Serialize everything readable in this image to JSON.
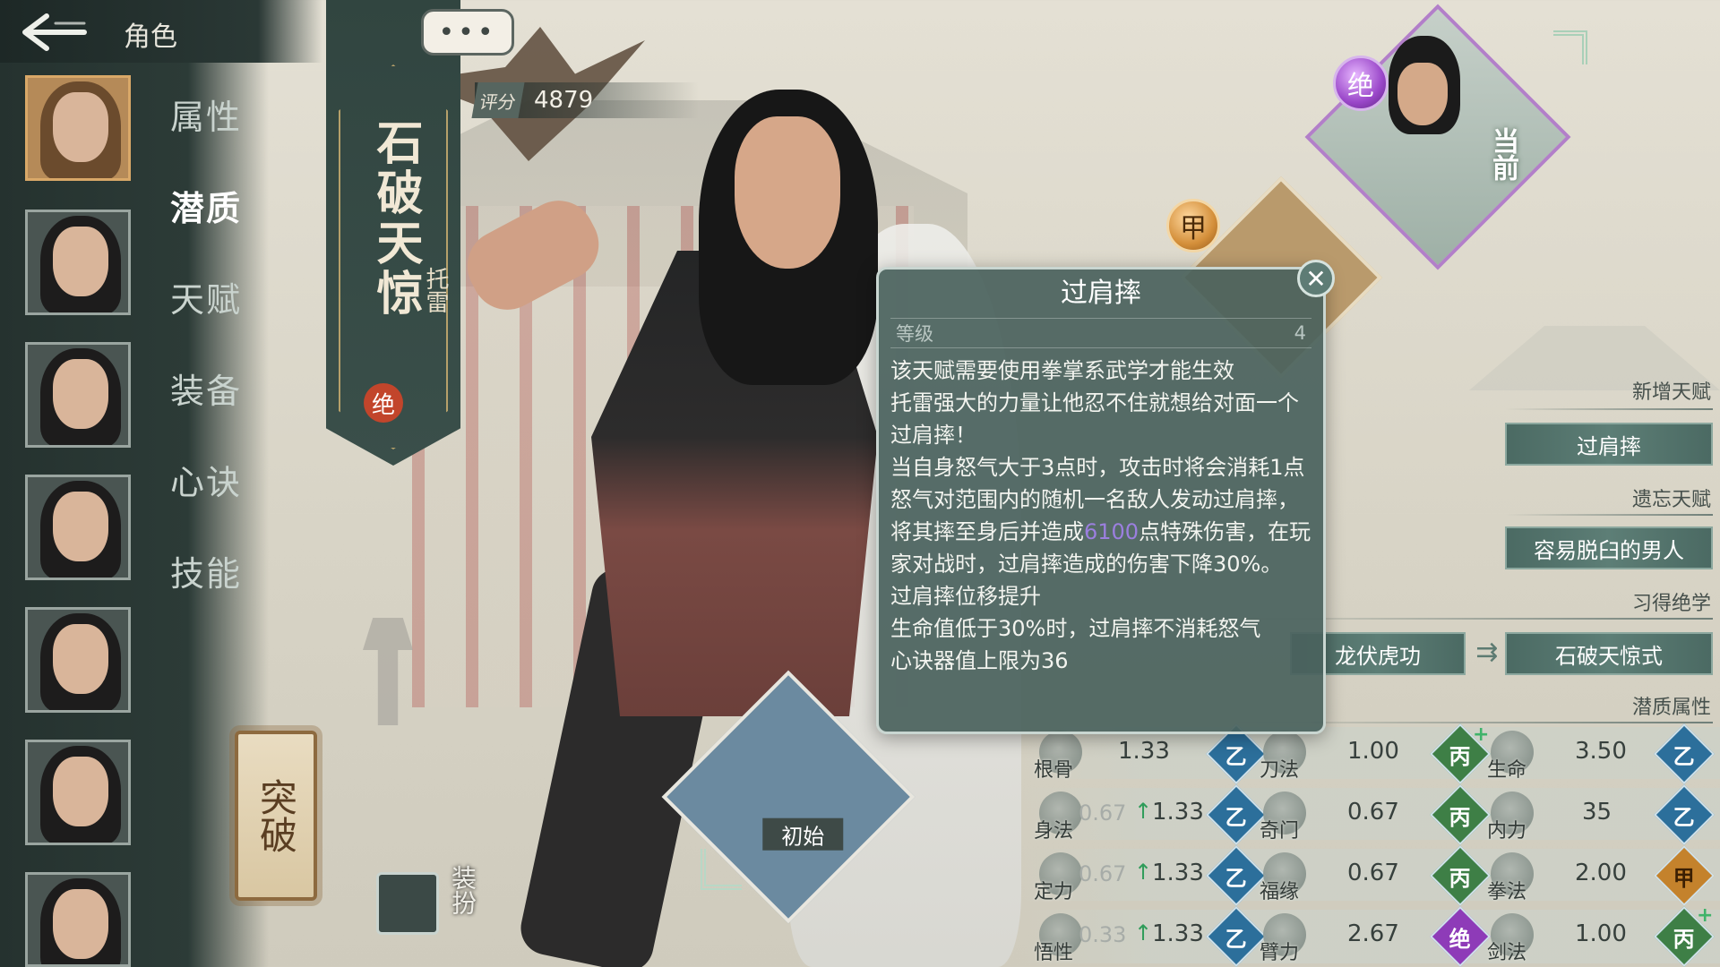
{
  "header": {
    "title": "角色"
  },
  "menu": [
    "属性",
    "潜质",
    "天赋",
    "装备",
    "心诀",
    "技能"
  ],
  "menu_selected": "潜质",
  "character": {
    "name": "石破天惊",
    "subtitle": "托雷",
    "grade": "绝",
    "score_label": "评分",
    "score": "4879"
  },
  "chat_button": "•••",
  "breakthrough_label": "突破",
  "dress_label": "装扮",
  "cards": {
    "current_label": "当前",
    "current_grade": "绝",
    "second_grade": "甲",
    "initial_label": "初始"
  },
  "tooltip": {
    "title": "过肩摔",
    "level_label": "等级",
    "level_value": "4",
    "lines": {
      "l1": "该天赋需要使用拳掌系武学才能生效",
      "l2": "托雷强大的力量让他忍不住就想给对面一个过肩摔！",
      "l3a": "当自身怒气大于3点时，攻击时将会消耗1点怒气对范围内的随机一名敌人发动过肩摔，将其摔至身后并造成",
      "l3num": "6100",
      "l3b": "点特殊伤害，在玩家对战时，过肩摔造成的伤害下降30%。",
      "l4": "过肩摔位移提升",
      "l5": "生命值低于30%时，过肩摔不消耗怒气",
      "l6": "心诀器值上限为36"
    },
    "highlight_color": "#9b7fdf",
    "close_icon": "close-icon"
  },
  "panel": {
    "new_talent_title": "新增天赋",
    "new_talent": "过肩摔",
    "forget_talent_title": "遗忘天赋",
    "forget_talent": "容易脱臼的男人",
    "skill_title": "习得绝学",
    "skill_from": "龙伏虎功",
    "skill_to": "石破天惊式",
    "potential_title": "潜质属性"
  },
  "stats": {
    "r1": {
      "c1": {
        "label": "根骨",
        "value": "1.33",
        "grade": "乙"
      },
      "c2": {
        "label": "刀法",
        "value": "1.00",
        "grade": "丙",
        "plus": "+"
      },
      "c3": {
        "label": "生命",
        "value": "3.50",
        "grade": "乙"
      }
    },
    "r2": {
      "c1": {
        "label": "身法",
        "old": "0.67",
        "arrow": "↑",
        "value": "1.33",
        "grade": "乙"
      },
      "c2": {
        "label": "奇门",
        "value": "0.67",
        "grade": "丙"
      },
      "c3": {
        "label": "内力",
        "value": "35",
        "grade": "乙"
      }
    },
    "r3": {
      "c1": {
        "label": "定力",
        "old": "0.67",
        "arrow": "↑",
        "value": "1.33",
        "grade": "乙"
      },
      "c2": {
        "label": "福缘",
        "value": "0.67",
        "grade": "丙"
      },
      "c3": {
        "label": "拳法",
        "value": "2.00",
        "grade": "甲"
      }
    },
    "r4": {
      "c1": {
        "label": "悟性",
        "old": "0.33",
        "arrow": "↑",
        "value": "1.33",
        "grade": "乙"
      },
      "c2": {
        "label": "臂力",
        "value": "2.67",
        "grade": "绝"
      },
      "c3": {
        "label": "剑法",
        "value": "1.00",
        "grade": "丙",
        "plus": "+"
      }
    }
  },
  "colors": {
    "panel_dark": "#2c3b37",
    "accent_gold": "#b6a06a",
    "grade_yi": "#2c6f9b",
    "grade_bing": "#3e7f46",
    "grade_jia": "#c4822c",
    "grade_jue": "#8e3bb8",
    "stat_up": "#2f9c5a"
  }
}
